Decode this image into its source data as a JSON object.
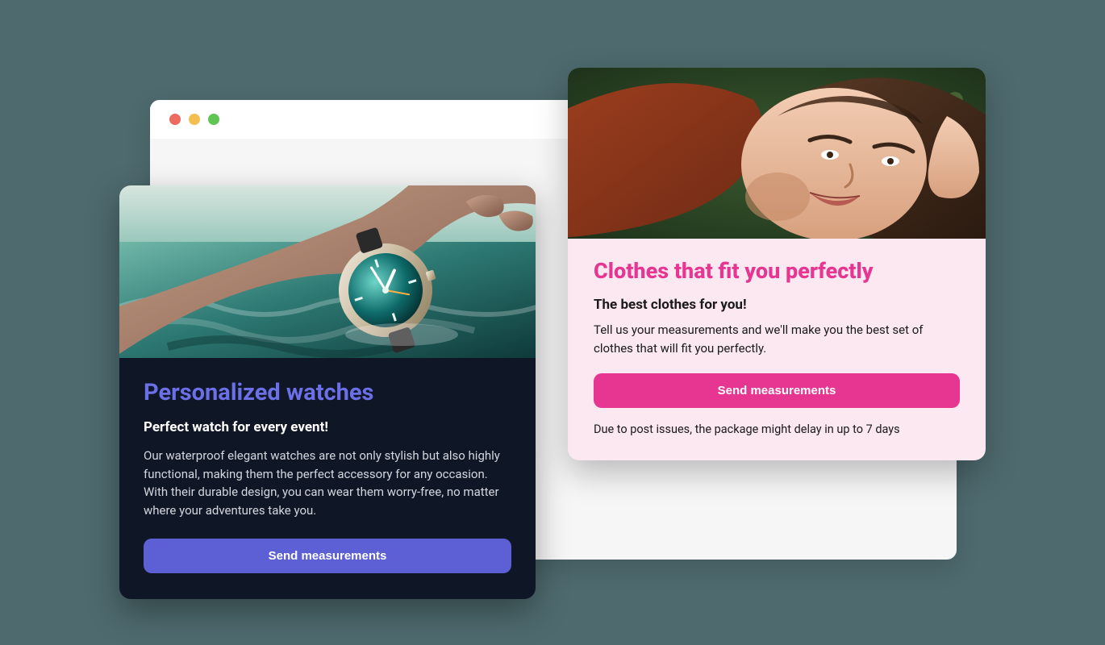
{
  "watches_card": {
    "title": "Personalized watches",
    "subtitle": "Perfect watch for every event!",
    "description": "Our waterproof elegant watches are not only stylish but also highly functional, making them the perfect accessory for any occasion. With their durable design, you can wear them worry-free, no matter where your adventures take you.",
    "button_label": "Send measurements"
  },
  "clothes_card": {
    "title": "Clothes that fit you perfectly",
    "subtitle": "The best clothes for you!",
    "description": "Tell us your measurements and we'll make you the best set of clothes that will fit you perfectly.",
    "button_label": "Send measurements",
    "note": "Due to post issues, the package might delay in up to 7 days"
  }
}
